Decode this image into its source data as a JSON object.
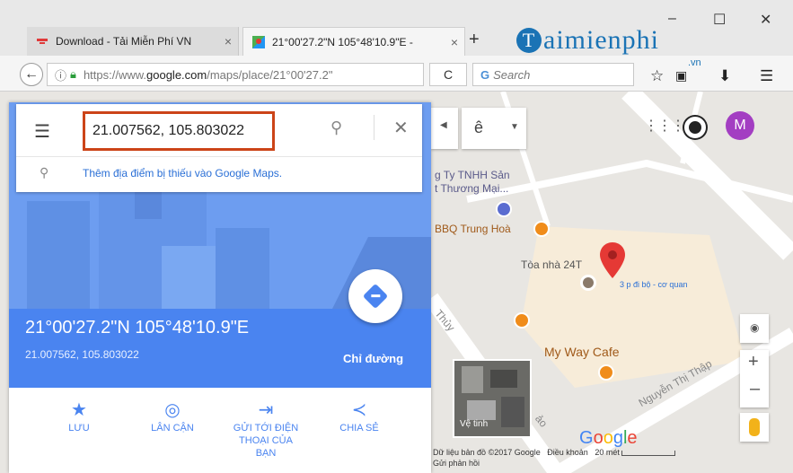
{
  "browser": {
    "tabs": [
      {
        "title": "Download - Tải Miễn Phí VN",
        "close": "×"
      },
      {
        "title": "21°00'27.2\"N 105°48'10.9\"E -",
        "close": "×"
      }
    ],
    "new_tab": "+",
    "window_buttons": {
      "minimize": "–",
      "maximize": "☐",
      "close": "✕"
    },
    "url_prefix": "https://www.",
    "url_domain": "google.com",
    "url_path": "/maps/place/21°00'27.2\"",
    "search_placeholder": "Search",
    "reload": "C",
    "watermark": {
      "logo_letter": "T",
      "logo_text": "aimienphi",
      "sub": ".vn"
    }
  },
  "panel": {
    "query": "21.007562, 105.803022",
    "add_missing": "Thêm địa điểm bị thiếu vào Google Maps.",
    "dms": "21°00'27.2\"N 105°48'10.9\"E",
    "decimal": "21.007562, 105.803022",
    "directions": "Chỉ đường",
    "actions": [
      {
        "label": "LƯU",
        "icon": "star-icon"
      },
      {
        "label": "LÂN CẬN",
        "icon": "nearby-icon"
      },
      {
        "label": "GỬI TỚI ĐIỆN THOẠI CỦA BẠN",
        "icon": "send-to-phone-icon"
      },
      {
        "label": "CHIA SẺ",
        "icon": "share-icon"
      }
    ]
  },
  "map": {
    "partial_control": "ê",
    "avatar": "M",
    "labels": {
      "company": "g Ty TNHH Sản\nt Thương Mại...",
      "bbq": "BBQ Trung Hoà",
      "building": "Tòa nhà 24T",
      "walk": "3 p đi bộ - cơ quan",
      "cafe": "My Way Cafe",
      "street1": "Thủy",
      "street2": "Nguyễn Thị Thập",
      "street3": "ảo"
    },
    "satellite_label": "Vệ tinh",
    "footer": {
      "data_credit": "Dữ liệu bản đồ ©2017 Google",
      "terms": "Điều khoản",
      "feedback": "Gửi phản hồi",
      "scale": "20 mét"
    }
  }
}
